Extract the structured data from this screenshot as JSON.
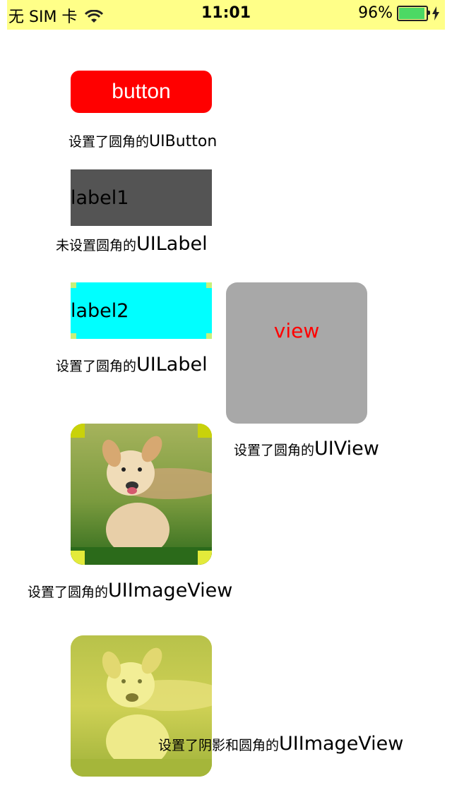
{
  "status_bar": {
    "carrier": "无 SIM 卡",
    "time": "11:01",
    "battery_percent": "96%",
    "battery_level": 0.96,
    "background_color": "#ffff88",
    "icons": [
      "wifi-icon",
      "battery-icon",
      "charging-bolt-icon"
    ]
  },
  "button": {
    "label": "button",
    "color": "#ff0000"
  },
  "captions": {
    "button": {
      "zh": "设置了圆角的",
      "en": "UIButton"
    },
    "label1": {
      "zh": "未设置圆角的",
      "en": "UILabel"
    },
    "label2": {
      "zh": "设置了圆角的",
      "en": "UILabel"
    },
    "view": {
      "zh": "设置了圆角的",
      "en": "UIView"
    },
    "imageview": {
      "zh": "设置了圆角的",
      "en": "UIImageView"
    },
    "shadow_imageview": {
      "zh": "设置了阴影和圆角的",
      "en": "UIImageView"
    }
  },
  "label1": {
    "text": "label1",
    "color": "#545454"
  },
  "label2": {
    "text": "label2",
    "color": "#00ffff"
  },
  "view": {
    "text": "view",
    "color": "#a8a8a8",
    "text_color": "#ff0000"
  },
  "images": [
    {
      "subject": "golden-retriever-puppy-running-on-grass"
    },
    {
      "subject": "golden-retriever-puppy-running-on-grass-yellow-tint"
    }
  ]
}
